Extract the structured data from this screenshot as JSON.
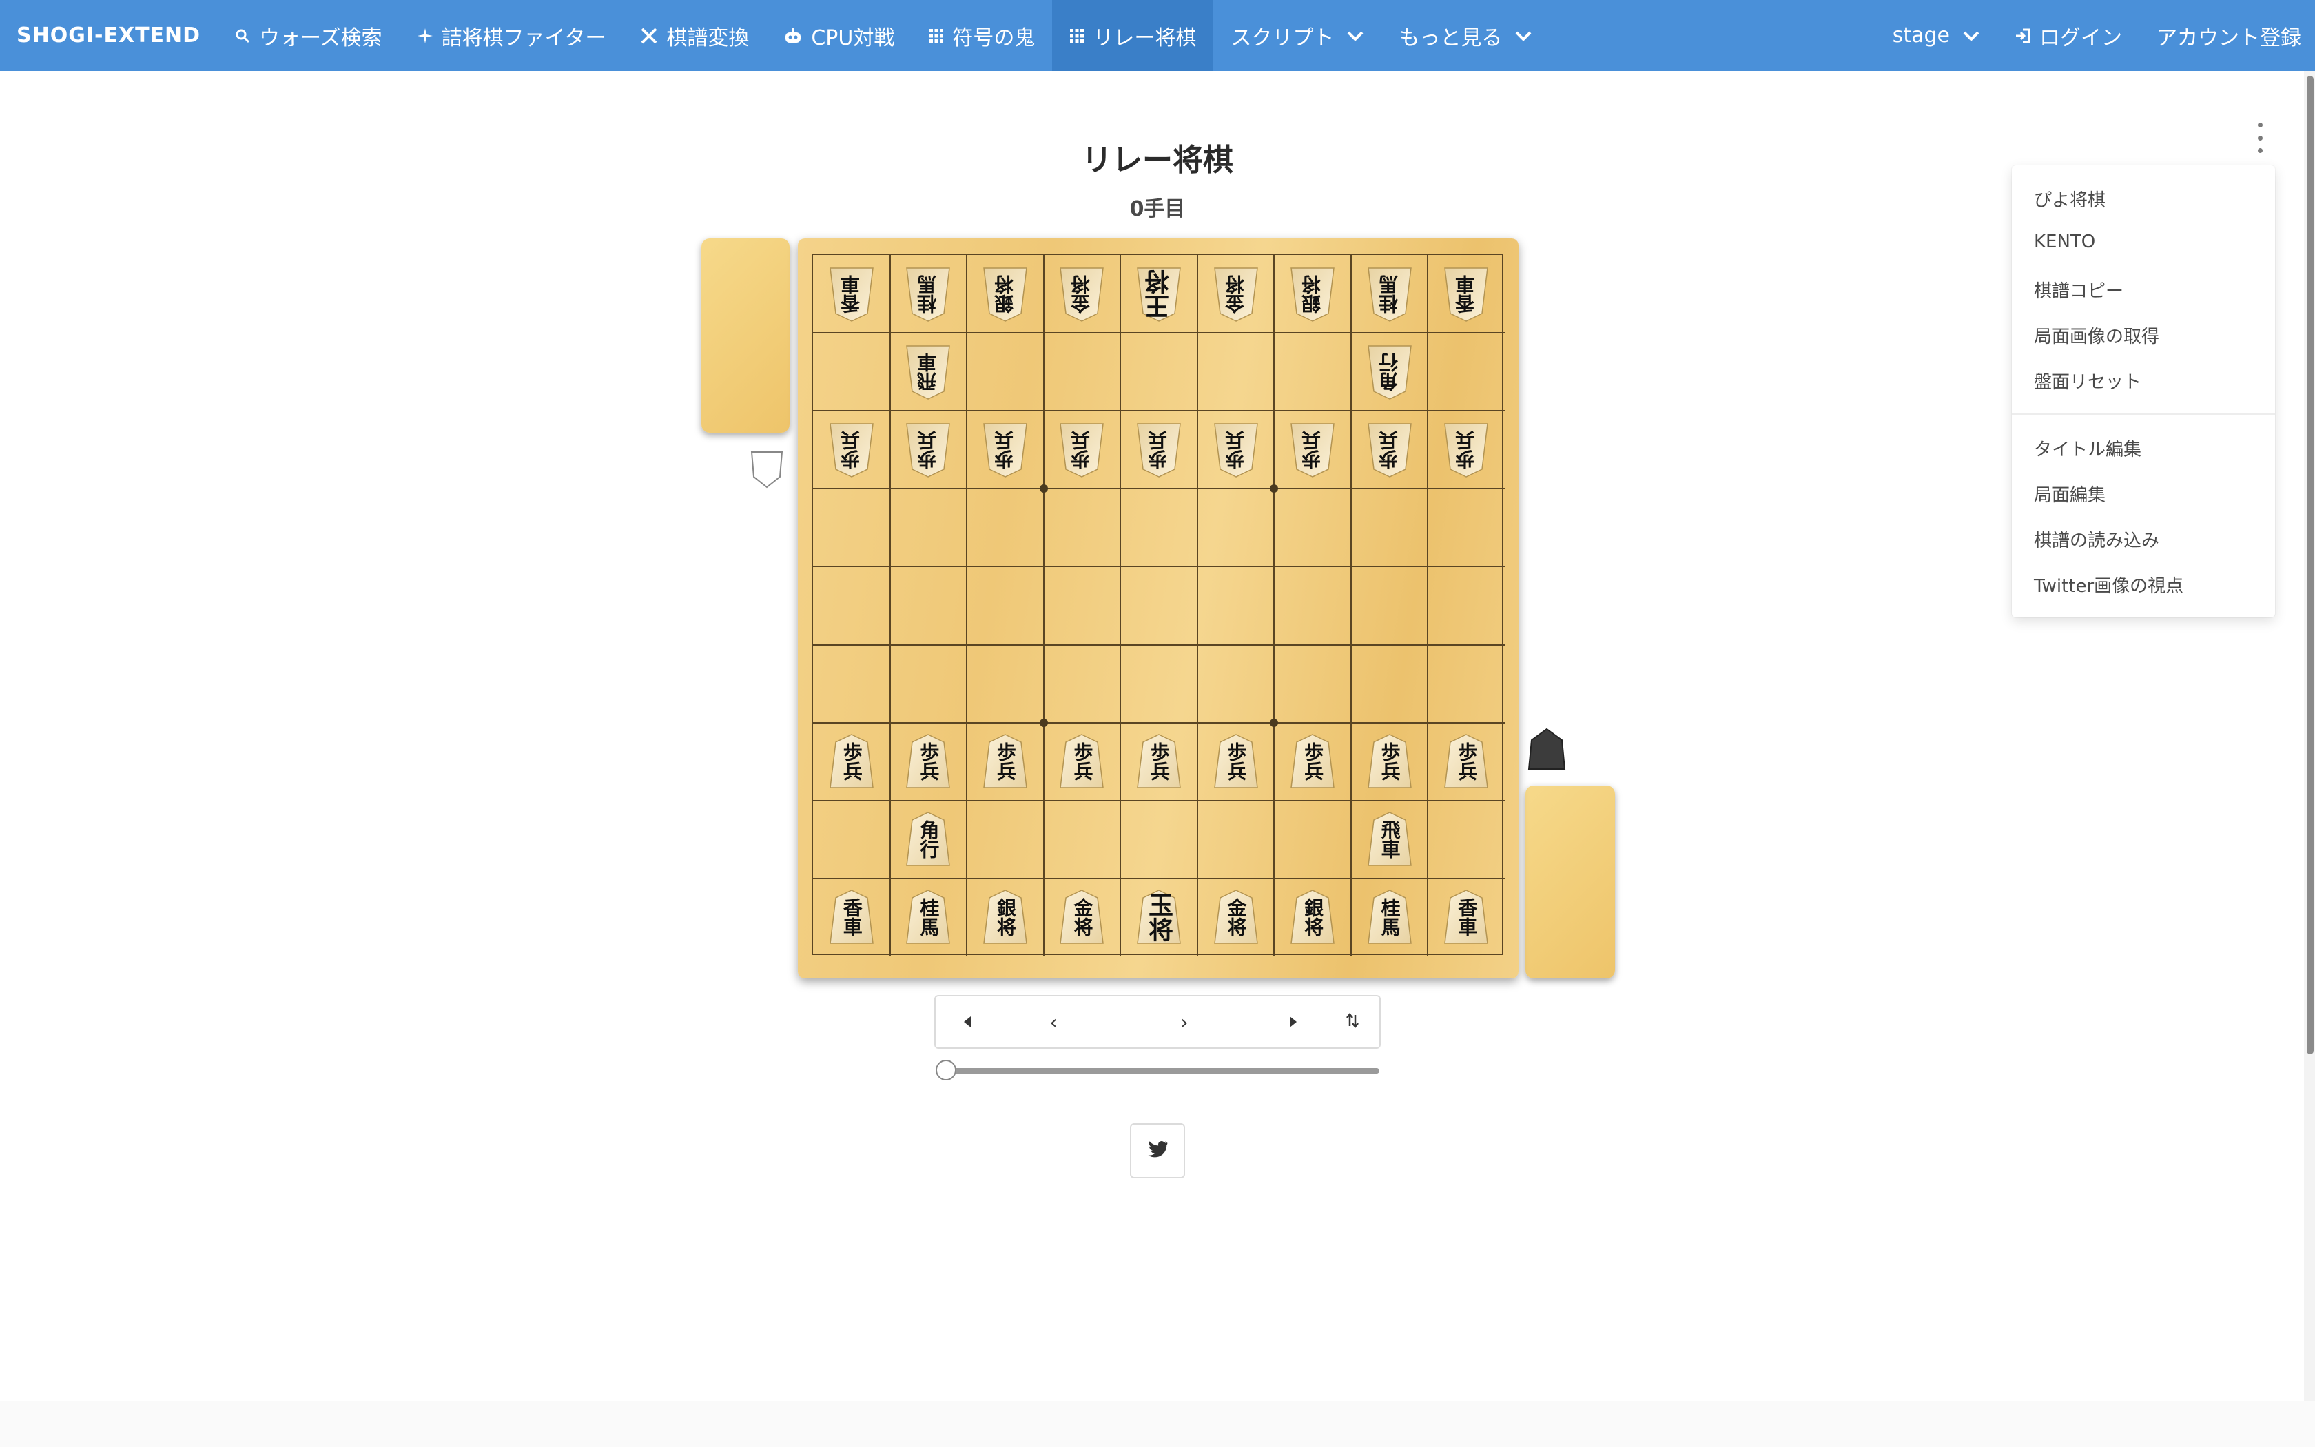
{
  "navbar": {
    "brand": "SHOGI-EXTEND",
    "items": [
      {
        "label": "ウォーズ検索",
        "icon": "search-icon"
      },
      {
        "label": "詰将棋ファイター",
        "icon": "sparkle-icon"
      },
      {
        "label": "棋譜変換",
        "icon": "tools-icon"
      },
      {
        "label": "CPU対戦",
        "icon": "robot-icon"
      },
      {
        "label": "符号の鬼",
        "icon": "grid-icon"
      },
      {
        "label": "リレー将棋",
        "icon": "grid-icon",
        "active": true
      },
      {
        "label": "スクリプト",
        "icon": "chevron-down-icon"
      },
      {
        "label": "もっと見る",
        "icon": "chevron-down-icon"
      }
    ],
    "right": {
      "stage": "stage",
      "login": "ログイン",
      "register": "アカウント登録"
    }
  },
  "page": {
    "title": "リレー将棋",
    "turn": "0手目"
  },
  "board": {
    "gote_rows": [
      [
        "香車",
        "桂馬",
        "銀将",
        "金将",
        "王将",
        "金将",
        "銀将",
        "桂馬",
        "香車"
      ],
      [
        "",
        "飛車",
        "",
        "",
        "",
        "",
        "",
        "角行",
        ""
      ],
      [
        "歩兵",
        "歩兵",
        "歩兵",
        "歩兵",
        "歩兵",
        "歩兵",
        "歩兵",
        "歩兵",
        "歩兵"
      ]
    ],
    "sente_rows": [
      [
        "歩兵",
        "歩兵",
        "歩兵",
        "歩兵",
        "歩兵",
        "歩兵",
        "歩兵",
        "歩兵",
        "歩兵"
      ],
      [
        "",
        "角行",
        "",
        "",
        "",
        "",
        "",
        "飛車",
        ""
      ],
      [
        "香車",
        "桂馬",
        "銀将",
        "金将",
        "玉将",
        "金将",
        "銀将",
        "桂馬",
        "香車"
      ]
    ]
  },
  "controls": {
    "first": "◀",
    "prev": "‹",
    "next": "›",
    "last": "▶",
    "flip": "⇅",
    "slider_value": 0
  },
  "menu": {
    "items_a": [
      "ぴよ将棋",
      "KENTO",
      "棋譜コピー",
      "局面画像の取得",
      "盤面リセット"
    ],
    "items_b": [
      "タイトル編集",
      "局面編集",
      "棋譜の読み込み",
      "Twitter画像の視点"
    ]
  },
  "colors": {
    "navbar": "#4a90d9",
    "navbar_active": "#3a7fc8",
    "board": "#f0c979"
  }
}
